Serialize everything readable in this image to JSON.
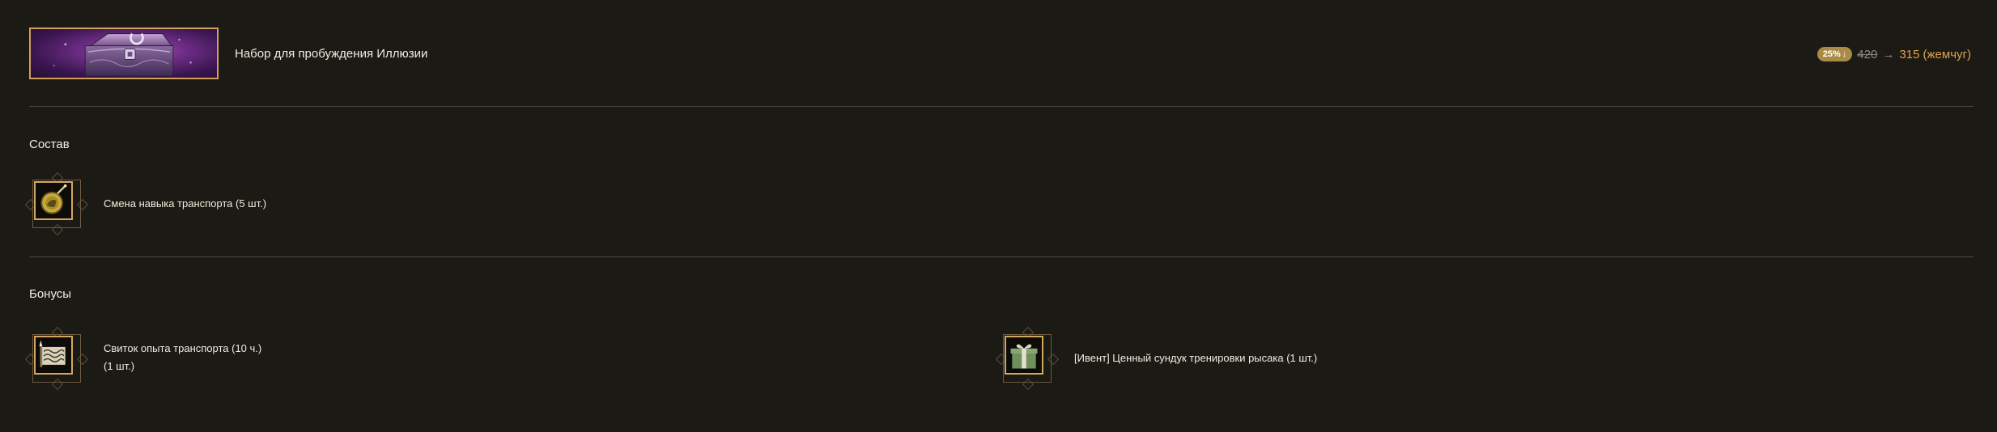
{
  "product": {
    "title": "Набор для пробуждения Иллюзии",
    "image": "purple-treasure-chest"
  },
  "price": {
    "discount": "25%",
    "discount_icon": "down-arrow-icon",
    "old_price": "420",
    "arrow": "→",
    "new_price": "315 (жемчуг)"
  },
  "composition": {
    "title": "Состав",
    "items": [
      {
        "label": "Смена навыка транспорта (5 шт.)",
        "icon": "horse-skill-change-icon"
      }
    ]
  },
  "bonuses": {
    "title": "Бонусы",
    "items": [
      {
        "label_line1": "Свиток опыта транспорта (10 ч.)",
        "label_line2": "(1 шт.)",
        "icon": "scroll-icon"
      },
      {
        "label": "[Ивент] Ценный сундук тренировки рысака (1 шт.)",
        "icon": "gift-box-icon"
      }
    ]
  },
  "colors": {
    "background": "#1b1a14",
    "accent_gold": "#d5a661",
    "price_orange": "#e0a24c",
    "badge": "#a98a46"
  }
}
